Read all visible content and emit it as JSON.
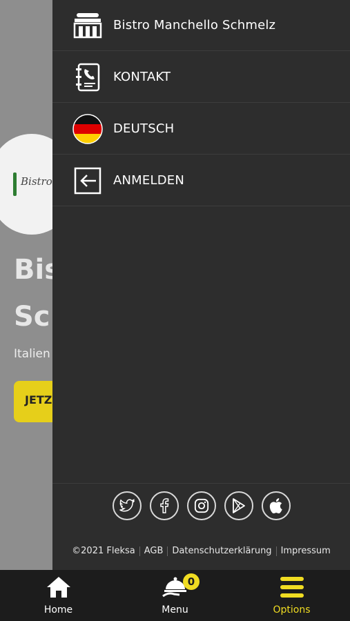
{
  "background": {
    "title_line1": "Bis",
    "title_line2": "Sc",
    "subtitle": "Italien",
    "button_label": "JETZ",
    "logo_text": "Bistro"
  },
  "drawer": {
    "items": [
      {
        "label": "Bistro Manchello Schmelz",
        "icon": "restaurant-icon"
      },
      {
        "label": "KONTAKT",
        "icon": "contact-book-icon"
      },
      {
        "label": "DEUTSCH",
        "icon": "german-flag-icon"
      },
      {
        "label": "ANMELDEN",
        "icon": "login-icon"
      }
    ],
    "social": [
      "twitter-icon",
      "facebook-icon",
      "instagram-icon",
      "google-play-icon",
      "apple-icon"
    ],
    "footer": {
      "copyright": "©2021 Fleksa",
      "agb": "AGB",
      "privacy": "Datenschutzerklärung",
      "imprint": "Impressum"
    }
  },
  "bottom_nav": {
    "home_label": "Home",
    "menu_label": "Menu",
    "options_label": "Options",
    "cart_count": "0"
  },
  "colors": {
    "accent": "#f0dc22",
    "drawer_bg": "#2d2d2d",
    "nav_bg": "#1c1c1c"
  }
}
